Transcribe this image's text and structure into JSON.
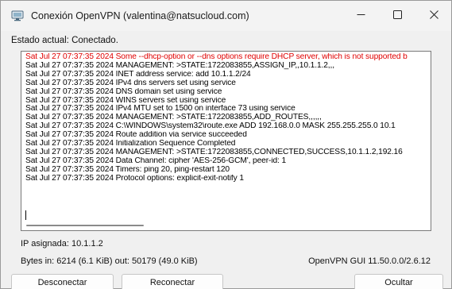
{
  "window": {
    "title": "Conexión OpenVPN (valentina@natsucloud.com)",
    "icons": {
      "app": "openvpn-monitor-icon",
      "minimize": "minimize-icon",
      "maximize": "maximize-icon",
      "close": "close-icon"
    }
  },
  "status": {
    "text": "Estado actual: Conectado."
  },
  "log": {
    "lines": [
      {
        "text": "Sat Jul 27 07:37:35 2024 Some --dhcp-option or --dns options require DHCP server, which is not supported b",
        "type": "error"
      },
      {
        "text": "Sat Jul 27 07:37:35 2024 MANAGEMENT: >STATE:1722083855,ASSIGN_IP,,10.1.1.2,,,",
        "type": "info"
      },
      {
        "text": "Sat Jul 27 07:37:35 2024 INET address service: add 10.1.1.2/24",
        "type": "info"
      },
      {
        "text": "Sat Jul 27 07:37:35 2024 IPv4 dns servers set using service",
        "type": "info"
      },
      {
        "text": "Sat Jul 27 07:37:35 2024 DNS domain set using service",
        "type": "info"
      },
      {
        "text": "Sat Jul 27 07:37:35 2024 WINS servers set using service",
        "type": "info"
      },
      {
        "text": "Sat Jul 27 07:37:35 2024 IPv4 MTU set to 1500 on interface 73 using service",
        "type": "info"
      },
      {
        "text": "Sat Jul 27 07:37:35 2024 MANAGEMENT: >STATE:1722083855,ADD_ROUTES,,,,,,",
        "type": "info"
      },
      {
        "text": "Sat Jul 27 07:37:35 2024 C:\\WINDOWS\\system32\\route.exe ADD 192.168.0.0 MASK 255.255.255.0 10.1",
        "type": "info"
      },
      {
        "text": "Sat Jul 27 07:37:35 2024 Route addition via service succeeded",
        "type": "info"
      },
      {
        "text": "Sat Jul 27 07:37:35 2024 Initialization Sequence Completed",
        "type": "info"
      },
      {
        "text": "Sat Jul 27 07:37:35 2024 MANAGEMENT: >STATE:1722083855,CONNECTED,SUCCESS,10.1.1.2,192.16",
        "type": "info"
      },
      {
        "text": "Sat Jul 27 07:37:35 2024 Data Channel: cipher 'AES-256-GCM', peer-id: 1",
        "type": "info"
      },
      {
        "text": "Sat Jul 27 07:37:35 2024 Timers: ping 20, ping-restart 120",
        "type": "info"
      },
      {
        "text": "Sat Jul 27 07:37:35 2024 Protocol options: explicit-exit-notify 1",
        "type": "info"
      }
    ],
    "colors": {
      "error": "#e00000",
      "info": "#000000"
    }
  },
  "info": {
    "ip": "IP asignada: 10.1.1.2",
    "bytes": "Bytes in: 6214 (6.1 KiB)  out: 50179 (49.0 KiB)",
    "version": "OpenVPN GUI 11.50.0.0/2.6.12"
  },
  "buttons": {
    "disconnect": "Desconectar",
    "reconnect": "Reconectar",
    "hide": "Ocultar"
  }
}
